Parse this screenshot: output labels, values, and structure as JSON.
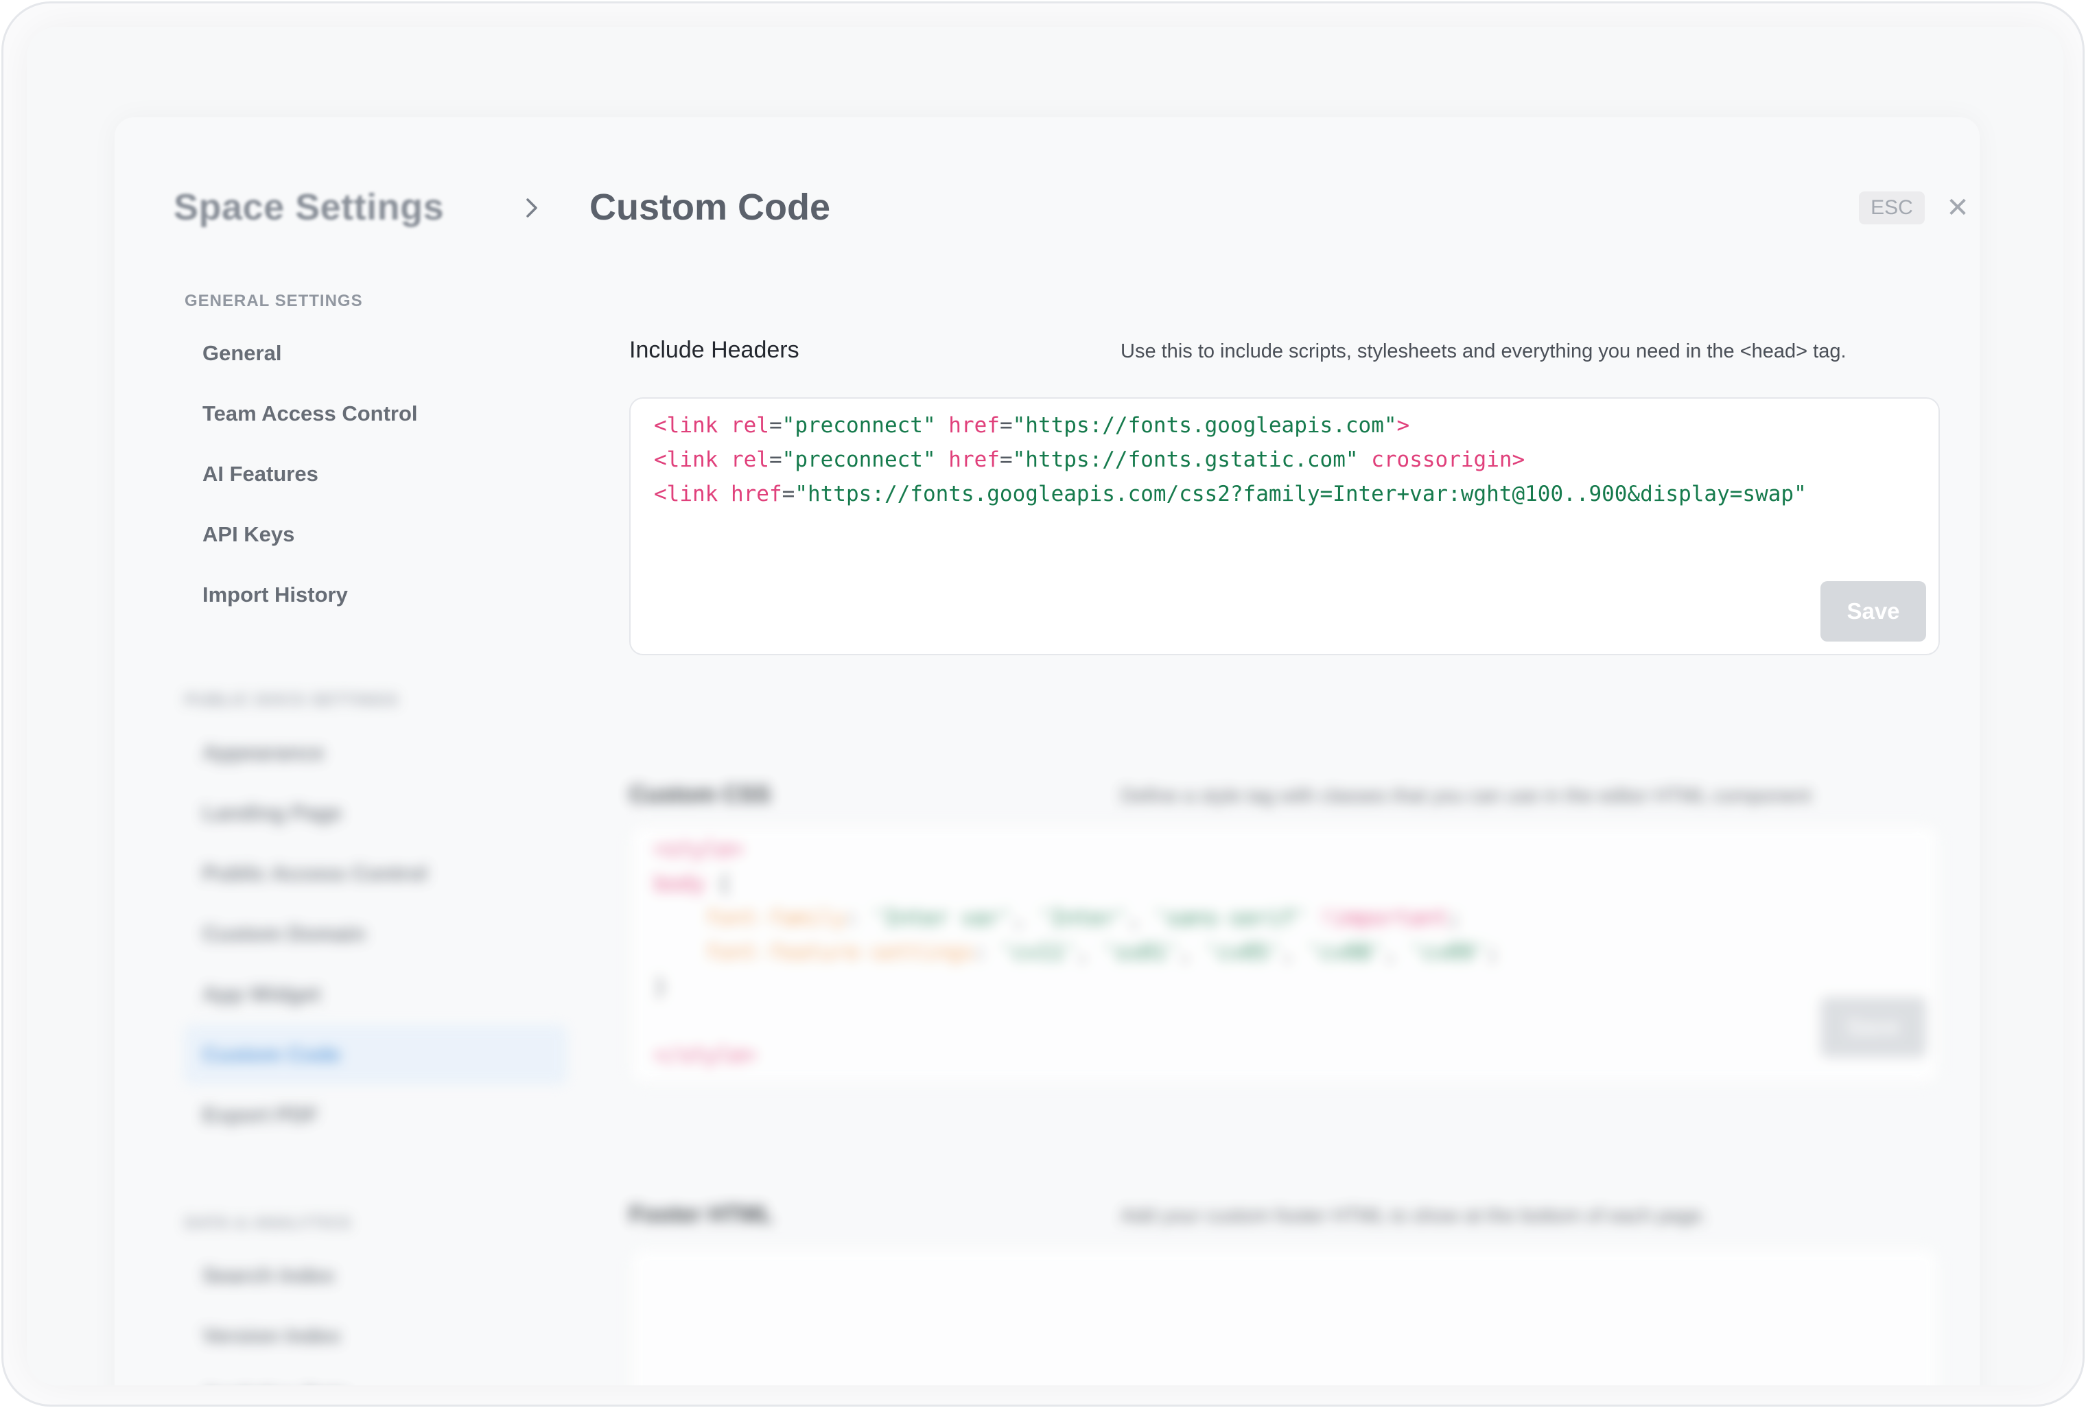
{
  "header": {
    "breadcrumb_root": "Space Settings",
    "title": "Custom Code",
    "esc_label": "ESC",
    "close_icon": "close-icon"
  },
  "sidebar": {
    "general_section_label": "GENERAL SETTINGS",
    "general_items": [
      {
        "label": "General"
      },
      {
        "label": "Team Access Control"
      },
      {
        "label": "AI Features"
      },
      {
        "label": "API Keys"
      },
      {
        "label": "Import History"
      }
    ],
    "public_section_label": "PUBLIC DOCS SETTINGS",
    "public_items": [
      {
        "label": "Appearance"
      },
      {
        "label": "Landing Page"
      },
      {
        "label": "Public Access Control"
      },
      {
        "label": "Custom Domain"
      },
      {
        "label": "App Widget"
      },
      {
        "label": "Custom Code",
        "active": true
      },
      {
        "label": "Export PDF"
      }
    ],
    "third_section_label": "DATA & ANALYTICS",
    "third_items": [
      {
        "label": "Search Index"
      },
      {
        "label": "Version Index"
      },
      {
        "label": "Analytics Data"
      }
    ]
  },
  "sections": {
    "headers": {
      "title": "Include Headers",
      "description": "Use this to include scripts, stylesheets and everything you need in the <head> tag.",
      "save_label": "Save",
      "code_lines": [
        [
          {
            "t": "<link ",
            "c": "tag"
          },
          {
            "t": "rel",
            "c": "attr"
          },
          {
            "t": "=",
            "c": "punc"
          },
          {
            "t": "\"preconnect\" ",
            "c": "str"
          },
          {
            "t": "href",
            "c": "attr"
          },
          {
            "t": "=",
            "c": "punc"
          },
          {
            "t": "\"https://fonts.googleapis.com\"",
            "c": "str"
          },
          {
            "t": ">",
            "c": "tag"
          }
        ],
        [
          {
            "t": "<link ",
            "c": "tag"
          },
          {
            "t": "rel",
            "c": "attr"
          },
          {
            "t": "=",
            "c": "punc"
          },
          {
            "t": "\"preconnect\" ",
            "c": "str"
          },
          {
            "t": "href",
            "c": "attr"
          },
          {
            "t": "=",
            "c": "punc"
          },
          {
            "t": "\"https://fonts.gstatic.com\" ",
            "c": "str"
          },
          {
            "t": "crossorigin>",
            "c": "attr"
          }
        ],
        [
          {
            "t": "<link ",
            "c": "tag"
          },
          {
            "t": "href",
            "c": "attr"
          },
          {
            "t": "=",
            "c": "punc"
          },
          {
            "t": "\"https://fonts.googleapis.com/css2?family=Inter+var:wght@100..900&display=swap\"",
            "c": "str"
          }
        ]
      ]
    },
    "css": {
      "title": "Custom CSS",
      "description": "Define a style tag with classes that you can use in the editor HTML component",
      "save_label": "Save",
      "code_lines": [
        [
          {
            "t": "<style>",
            "c": "tag"
          }
        ],
        [
          {
            "t": "body",
            "c": "tag"
          },
          {
            "t": " {",
            "c": "punc"
          }
        ],
        [
          {
            "t": "    font-family",
            "c": "prop"
          },
          {
            "t": ": ",
            "c": "punc"
          },
          {
            "t": "'Inter var'",
            "c": "str"
          },
          {
            "t": ", ",
            "c": "punc"
          },
          {
            "t": "'Inter'",
            "c": "str"
          },
          {
            "t": ", ",
            "c": "punc"
          },
          {
            "t": "'sans-serif'",
            "c": "str"
          },
          {
            "t": " !important",
            "c": "tag"
          },
          {
            "t": ";",
            "c": "punc"
          }
        ],
        [
          {
            "t": "    font-feature-settings",
            "c": "prop"
          },
          {
            "t": ": ",
            "c": "punc"
          },
          {
            "t": "'cv11'",
            "c": "str"
          },
          {
            "t": ", ",
            "c": "punc"
          },
          {
            "t": "'ss01'",
            "c": "str"
          },
          {
            "t": ", ",
            "c": "punc"
          },
          {
            "t": "'cv05'",
            "c": "str"
          },
          {
            "t": ", ",
            "c": "punc"
          },
          {
            "t": "'cv08'",
            "c": "str"
          },
          {
            "t": ", ",
            "c": "punc"
          },
          {
            "t": "'cv09'",
            "c": "str"
          },
          {
            "t": ";",
            "c": "punc"
          }
        ],
        [
          {
            "t": "}",
            "c": "punc"
          }
        ],
        [
          {
            "t": "",
            "c": "punc"
          }
        ],
        [
          {
            "t": "</style>",
            "c": "tag"
          }
        ]
      ]
    },
    "footer": {
      "title": "Footer HTML",
      "description": "Add your custom footer HTML to show at the bottom of each page."
    }
  },
  "colors": {
    "accent": "#4a90d9",
    "code_tag": "#e0407b",
    "code_string": "#157a4c",
    "save_disabled": "#d6d9dd"
  }
}
